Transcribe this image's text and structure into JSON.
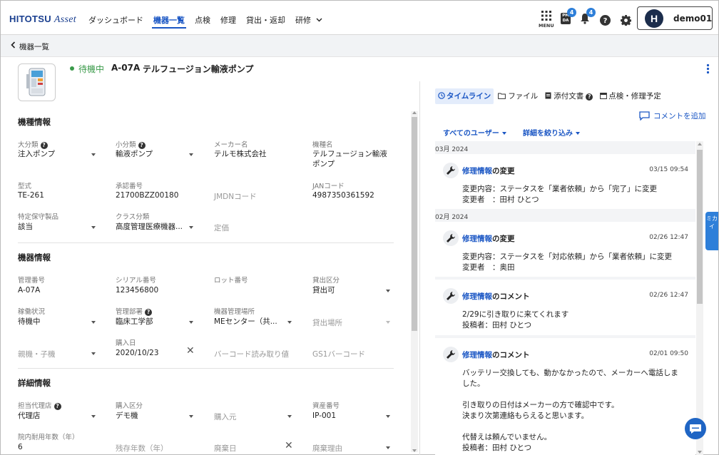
{
  "brand": {
    "name": "HITOTSU",
    "suffix": "Asset"
  },
  "nav": {
    "items": [
      "ダッシュボード",
      "機器一覧",
      "点検",
      "修理",
      "貸出・返却",
      "研修"
    ],
    "active": 1
  },
  "header": {
    "menu_label": "MENU",
    "pmda_label": "PM DA",
    "pmda_badge": "4",
    "bell_badge": "4",
    "user": {
      "initial": "H",
      "name": "demo01"
    }
  },
  "breadcrumb": {
    "back_label": "機器一覧"
  },
  "device": {
    "status": "待機中",
    "id": "A-07A",
    "name": "テルフュージョン輸液ポンプ"
  },
  "sections": {
    "model": {
      "title": "機種情報",
      "major_category": {
        "label": "大分類",
        "value": "注入ポンプ"
      },
      "minor_category": {
        "label": "小分類",
        "value": "輸液ポンプ"
      },
      "maker": {
        "label": "メーカー名",
        "value": "テルモ株式会社"
      },
      "model_name": {
        "label": "機種名",
        "value": "テルフュージョン輸液ポンプ"
      },
      "model_no": {
        "label": "型式",
        "value": "TE-261"
      },
      "approval_no": {
        "label": "承認番号",
        "value": "21700BZZ00180"
      },
      "jmdn": {
        "placeholder": "JMDNコード"
      },
      "jan": {
        "label": "JANコード",
        "value": "4987350361592"
      },
      "specified": {
        "label": "特定保守製品",
        "value": "該当"
      },
      "class": {
        "label": "クラス分類",
        "value": "高度管理医療機器..."
      },
      "price": {
        "placeholder": "定価"
      }
    },
    "device_info": {
      "title": "機器情報",
      "mgmt_no": {
        "label": "管理番号",
        "value": "A-07A"
      },
      "serial_no": {
        "label": "シリアル番号",
        "value": "123456800"
      },
      "lot_no": {
        "label": "ロット番号"
      },
      "lending": {
        "label": "貸出区分",
        "value": "貸出可"
      },
      "operation": {
        "label": "稼働状況",
        "value": "待機中"
      },
      "dept": {
        "label": "管理部署",
        "value": "臨床工学部"
      },
      "location": {
        "label": "機器管理場所",
        "value": "MEセンター（共..."
      },
      "lend_place": {
        "placeholder": "貸出場所"
      },
      "parent_child": {
        "placeholder": "親機・子機"
      },
      "purchase_date": {
        "label": "購入日",
        "value": "2020/10/23"
      },
      "barcode": {
        "placeholder": "バーコード読み取り値"
      },
      "gs1": {
        "placeholder": "GS1バーコード"
      }
    },
    "detail": {
      "title": "詳細情報",
      "agency": {
        "label": "担当代理店",
        "value": "代理店"
      },
      "purchase_type": {
        "label": "購入区分",
        "value": "デモ機"
      },
      "purchase_from": {
        "placeholder": "購入元"
      },
      "asset_no": {
        "label": "資産番号",
        "value": "IP-001"
      },
      "durable_years": {
        "label": "院内耐用年数（年）",
        "value": "6"
      },
      "remaining": {
        "placeholder": "残存年数（年）"
      },
      "disposal_date": {
        "placeholder": "廃棄日"
      },
      "disposal_reason": {
        "placeholder": "廃棄理由"
      }
    }
  },
  "timeline": {
    "tabs": [
      "タイムライン",
      "ファイル",
      "添付文書",
      "点検・修理予定"
    ],
    "add_comment": "コメントを追加",
    "filters": {
      "users": "すべてのユーザー",
      "details": "詳細を絞り込み"
    },
    "months": [
      "03月 2024",
      "02月 2024"
    ],
    "entries": [
      {
        "title_link": "修理情報",
        "title_rest": "の変更",
        "date": "03/15 09:54",
        "lines": [
          "変更内容：ステータスを「業者依頼」から「完了」に変更",
          "変更者　：田村 ひとつ"
        ]
      },
      {
        "title_link": "修理情報",
        "title_rest": "の変更",
        "date": "02/26 12:47",
        "lines": [
          "変更内容：ステータスを「対応依頼」から「業者依頼」に変更",
          "変更者　：奥田"
        ]
      },
      {
        "title_link": "修理情報",
        "title_rest": "のコメント",
        "date": "02/26 12:47",
        "lines": [
          "2/29に引き取りに来てくれます",
          "投稿者：田村 ひとつ"
        ]
      },
      {
        "title_link": "修理情報",
        "title_rest": "のコメント",
        "date": "02/01 09:50",
        "lines": [
          "バッテリー交換しても、動かなかったので、メーカーへ電話しました。",
          "",
          "引き取りの日付はメーカーの方で確認中です。",
          "決まり次第連絡もらえると思います。",
          "",
          "代替えは頼んでいません。",
          "投稿者：田村 ひとつ"
        ]
      }
    ]
  },
  "side_tab": "ミカイ",
  "colors": {
    "accent": "#1a56c4",
    "status_green": "#3a9a4a",
    "badge_blue": "#2e7fd9"
  }
}
